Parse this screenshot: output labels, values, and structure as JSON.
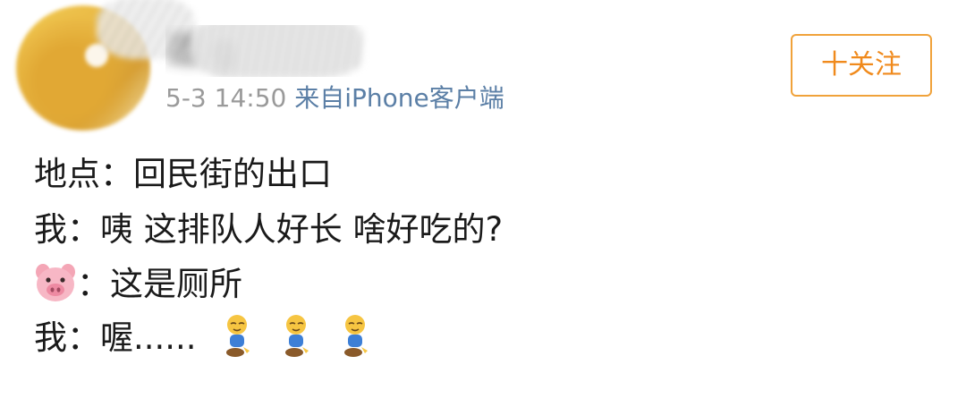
{
  "header": {
    "username": "逗 g",
    "time": "5-3 14:50",
    "source": "来自iPhone客户端",
    "follow_label": "十关注"
  },
  "post": {
    "line1": "地点：回民街的出口",
    "line2": "我：咦 这排队人好长 啥好吃的?",
    "line3_text": "：这是厕所",
    "line4_text": "我：喔......",
    "emojis": [
      "pig-face",
      "kneeling-person",
      "kneeling-person",
      "kneeling-person"
    ]
  },
  "colors": {
    "accent": "#f08a1c",
    "meta": "#9a9a9a",
    "link": "#5b7fa6",
    "text": "#1a1a1a"
  }
}
